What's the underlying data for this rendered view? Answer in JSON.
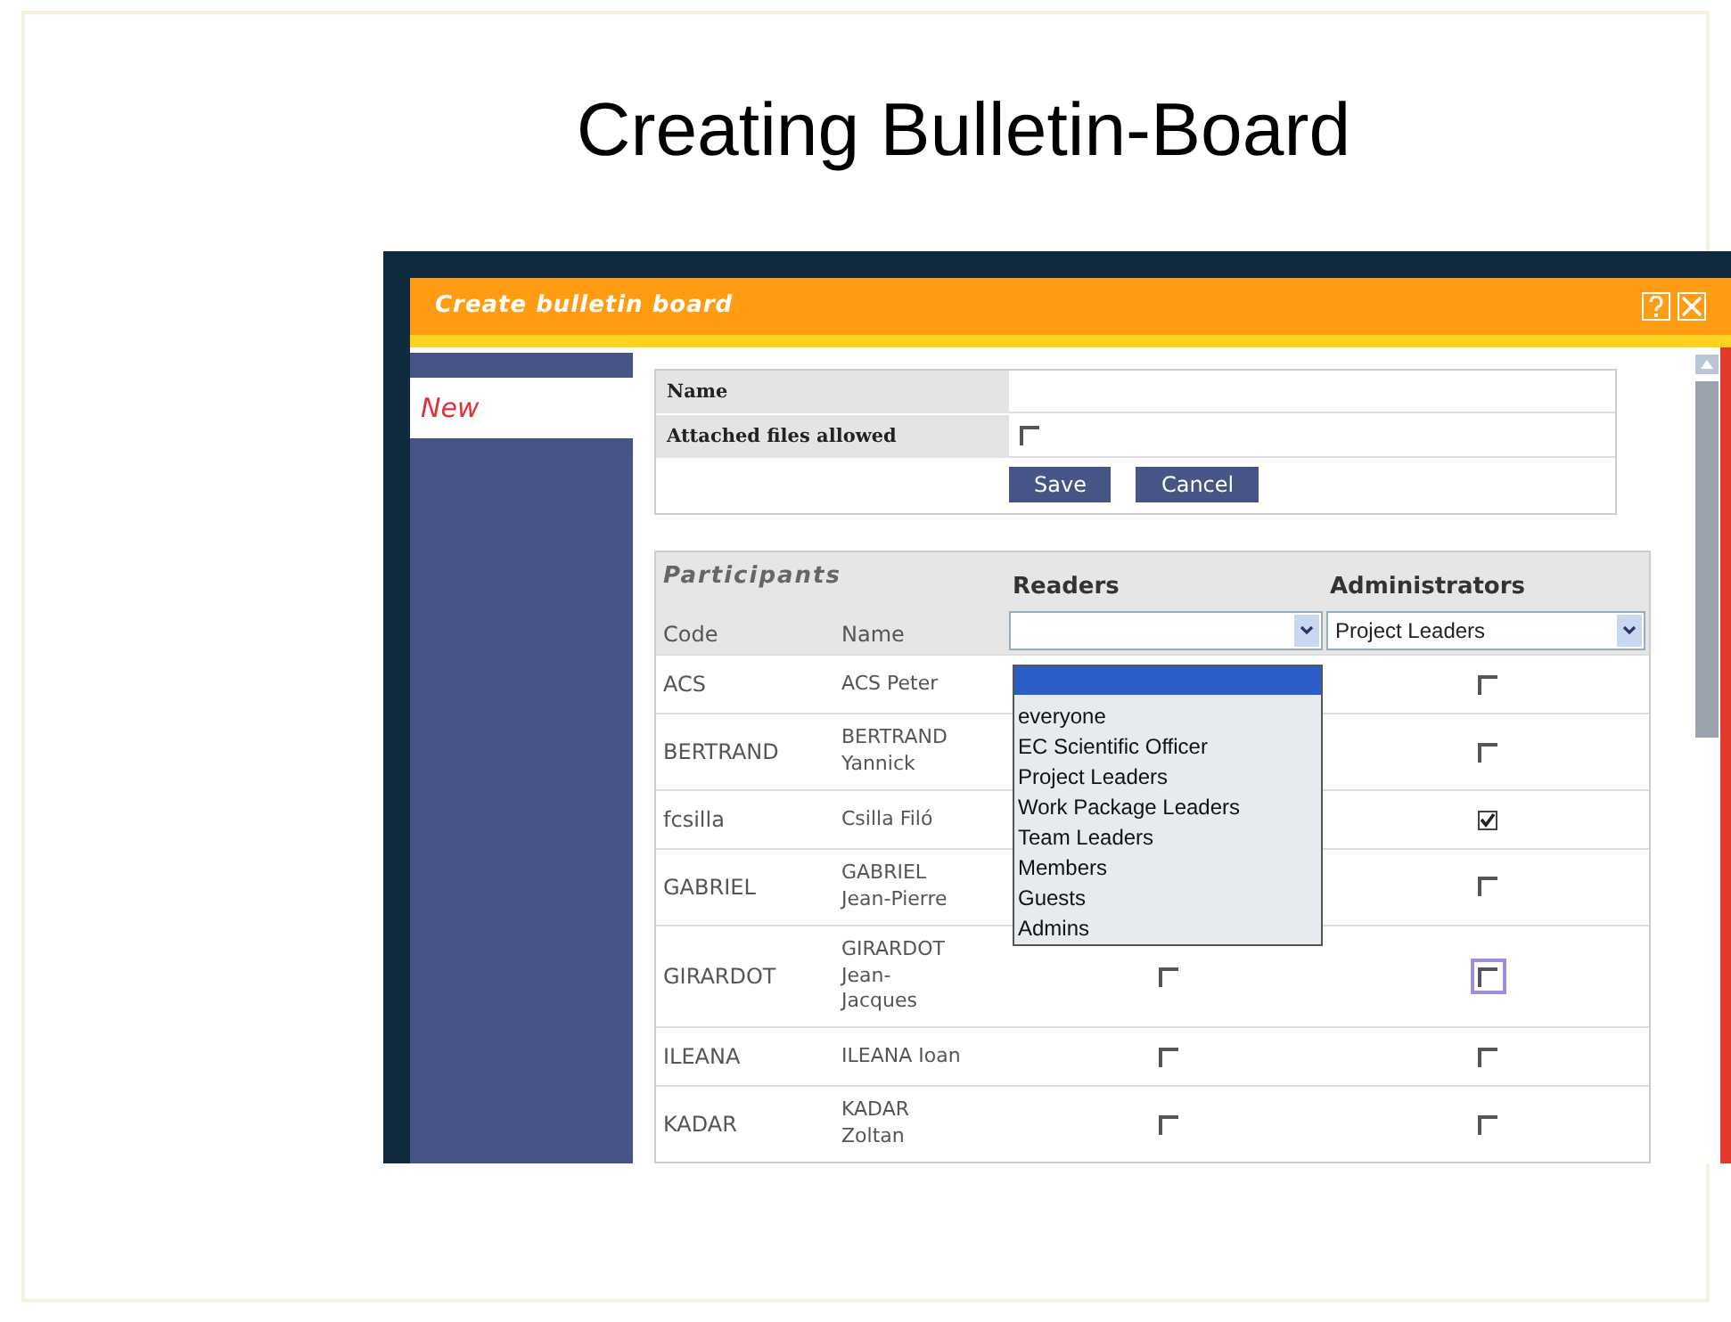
{
  "slide": {
    "title": "Creating Bulletin-Board"
  },
  "window": {
    "title": "Create bulletin board"
  },
  "sidebar": {
    "items": [
      {
        "label": "New",
        "selected": true
      }
    ]
  },
  "form": {
    "fields": [
      {
        "kind": "text",
        "label": "Name"
      },
      {
        "kind": "checkbox",
        "label": "Attached files allowed",
        "checked": false
      }
    ],
    "buttons": [
      "Save",
      "Cancel"
    ]
  },
  "participants": {
    "title": "Participants",
    "role_headers": [
      "Readers",
      "Administrators"
    ],
    "columns": [
      "Code",
      "Name"
    ],
    "readers_select": {
      "open": true,
      "options": [
        "everyone",
        "EC Scientific Officer",
        "Project Leaders",
        "Work Package Leaders",
        "Team Leaders",
        "Members",
        "Guests",
        "Admins"
      ]
    },
    "admins_select": {
      "value": "Project Leaders"
    },
    "rows": [
      {
        "code": "ACS",
        "name": "ACS Peter",
        "admin": false
      },
      {
        "code": "BERTRAND",
        "name": "BERTRAND Yannick",
        "admin": false
      },
      {
        "code": "fcsilla",
        "name": "Csilla Filó",
        "admin": true
      },
      {
        "code": "GABRIEL",
        "name": "GABRIEL Jean-Pierre",
        "admin": false
      },
      {
        "code": "GIRARDOT",
        "name": "GIRARDOT Jean-Jacques",
        "reader": false,
        "admin": false,
        "focused": true
      },
      {
        "code": "ILEANA",
        "name": "ILEANA Ioan",
        "reader": false,
        "admin": false
      },
      {
        "code": "KADAR",
        "name": "KADAR Zoltan",
        "reader": false,
        "admin": false
      }
    ]
  }
}
